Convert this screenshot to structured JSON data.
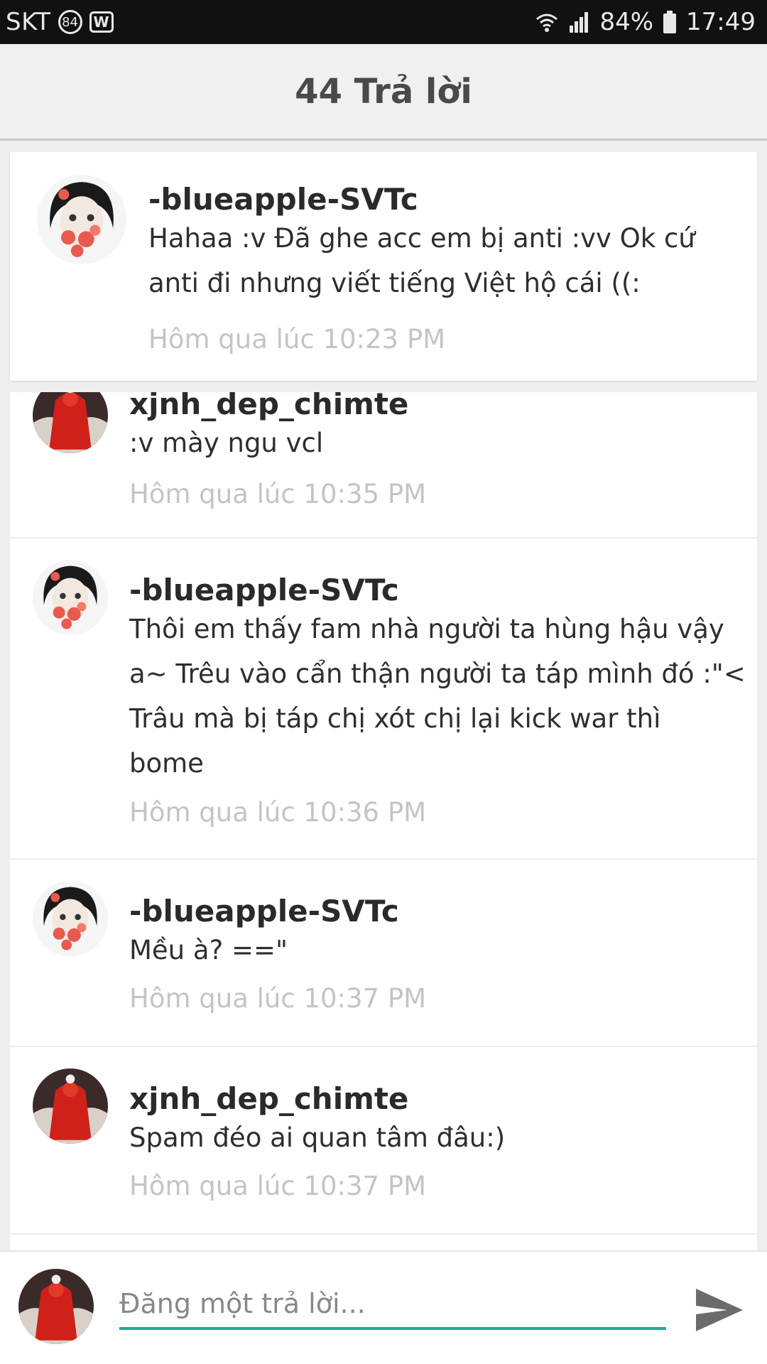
{
  "status_bar": {
    "carrier": "SKT",
    "badge": "84",
    "w_icon": "W",
    "battery": "84%",
    "time": "17:49",
    "icons": [
      "wifi-icon",
      "signal-icon",
      "battery-icon"
    ]
  },
  "header": {
    "title": "44 Trả lời"
  },
  "featured": {
    "author": "-blueapple-SVTc",
    "text": "Hahaa :v Đã ghe acc em bị anti :vv Ok cứ\nanti đi nhưng viết tiếng Việt hộ cái ((:",
    "time": "Hôm qua lúc 10:23 PM"
  },
  "comments": [
    {
      "author": "xjnh_dep_chimte",
      "text": ":v mày ngu vcl",
      "time": "Hôm qua lúc 10:35 PM",
      "avatar": "red-avatar"
    },
    {
      "author": "-blueapple-SVTc",
      "text": "Thôi em thấy fam nhà người ta hùng hậu vậy\na~ Trêu vào cẩn thận người ta táp mình đó :\"<\nTrâu mà bị táp chị xót chị lại kick war thì\nbome",
      "time": "Hôm qua lúc 10:36 PM",
      "avatar": "girl-avatar"
    },
    {
      "author": "-blueapple-SVTc",
      "text": "Mều à? ==\"",
      "time": "Hôm qua lúc 10:37 PM",
      "avatar": "girl-avatar"
    },
    {
      "author": "xjnh_dep_chimte",
      "text": "Spam đéo ai quan tâm đâu:)",
      "time": "Hôm qua lúc 10:37 PM",
      "avatar": "red-avatar"
    }
  ],
  "reply": {
    "placeholder": "Đăng một trả lời...",
    "send_icon": "send-icon"
  },
  "colors": {
    "accent": "#26a69a",
    "time_text": "#c4c4c4",
    "status_bar": "#111111"
  }
}
